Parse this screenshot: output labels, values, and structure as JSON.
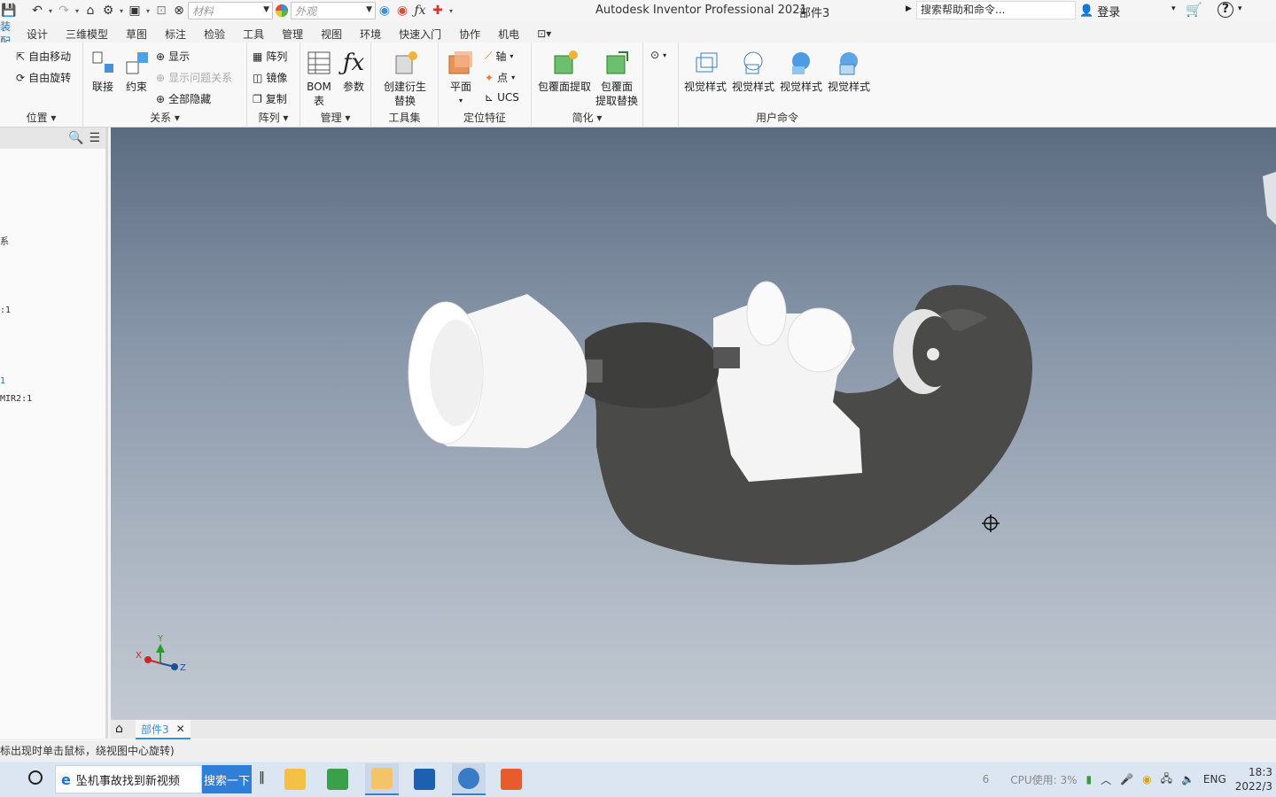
{
  "app": {
    "title": "Autodesk Inventor Professional 2021",
    "document": "部件3",
    "help_search": "搜索帮助和命令...",
    "login": "登录"
  },
  "quick_access": {
    "material_placeholder": "材料",
    "appearance_placeholder": "外观"
  },
  "menu": [
    "装配",
    "设计",
    "三维模型",
    "草图",
    "标注",
    "检验",
    "工具",
    "管理",
    "视图",
    "环境",
    "快速入门",
    "协作",
    "机电"
  ],
  "ribbon": {
    "position": {
      "label": "位置",
      "free_move": "自由移动",
      "free_rotate": "自由旋转"
    },
    "relations": {
      "label": "关系",
      "joint": "联接",
      "constrain": "约束",
      "show": "显示",
      "show_problem": "显示问题关系",
      "hide_all": "全部隐藏"
    },
    "pattern": {
      "label": "阵列",
      "pattern": "阵列",
      "mirror": "镜像",
      "copy": "复制"
    },
    "manage": {
      "label": "管理",
      "bom": "BOM",
      "bom2": "表",
      "params": "参数"
    },
    "toolset": {
      "label": "工具集",
      "derive": "创建衍生",
      "derive2": "替换"
    },
    "work_features": {
      "label": "定位特征",
      "plane": "平面",
      "axis": "轴",
      "point": "点",
      "ucs": "UCS"
    },
    "simplify": {
      "label": "简化",
      "shrinkwrap": "包覆面提取",
      "shrinkwrap_sub1": "包覆面",
      "shrinkwrap_sub2": "提取替换"
    },
    "user_commands": {
      "label": "用户命令",
      "items": [
        "视觉样式",
        "视觉样式",
        "视觉样式",
        "视觉样式"
      ]
    }
  },
  "browser": {
    "items": [
      "系",
      ":1",
      "1",
      "MIR2:1"
    ]
  },
  "viewport": {
    "triad": {
      "x": "X",
      "y": "Y",
      "z": "Z"
    }
  },
  "doc_tab": {
    "name": "部件3"
  },
  "status": "标出现时单击鼠标，绕视图中心旋转)",
  "taskbar": {
    "search_text": "坠机事故找到新视频",
    "search_button": "搜索一下",
    "tray_number": "6",
    "cpu": "CPU使用: 3%",
    "lang": "ENG",
    "time": "18:3",
    "date": "2022/3"
  }
}
